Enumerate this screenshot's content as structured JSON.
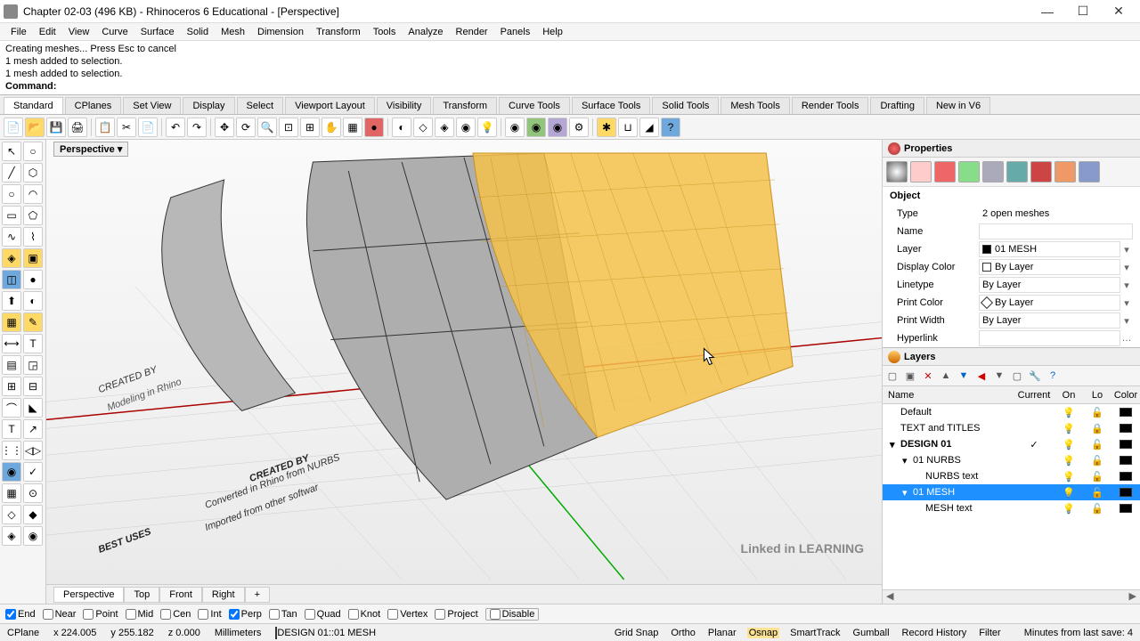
{
  "window": {
    "title": "Chapter 02-03 (496 KB) - Rhinoceros 6 Educational - [Perspective]"
  },
  "menu": [
    "File",
    "Edit",
    "View",
    "Curve",
    "Surface",
    "Solid",
    "Mesh",
    "Dimension",
    "Transform",
    "Tools",
    "Analyze",
    "Render",
    "Panels",
    "Help"
  ],
  "command_history": [
    "Creating meshes... Press Esc to cancel",
    "1 mesh added to selection.",
    "1 mesh added to selection."
  ],
  "command_prompt": "Command:",
  "toolbar_tabs": [
    "Standard",
    "CPlanes",
    "Set View",
    "Display",
    "Select",
    "Viewport Layout",
    "Visibility",
    "Transform",
    "Curve Tools",
    "Surface Tools",
    "Solid Tools",
    "Mesh Tools",
    "Render Tools",
    "Drafting",
    "New in V6"
  ],
  "viewport": {
    "label": "Perspective",
    "annotations": {
      "created_by1": "CREATED BY",
      "created_by2": "CREATED BY",
      "sub1": "Converted in Rhino from NURBS",
      "sub2": "Imported from other softwar",
      "best_uses": "BEST USES",
      "small": "Modeling in Rhino"
    }
  },
  "view_tabs": [
    "Perspective",
    "Top",
    "Front",
    "Right"
  ],
  "properties": {
    "title": "Properties",
    "section": "Object",
    "rows": {
      "type": {
        "label": "Type",
        "value": "2 open meshes"
      },
      "name": {
        "label": "Name",
        "value": ""
      },
      "layer": {
        "label": "Layer",
        "value": "01 MESH"
      },
      "display_color": {
        "label": "Display Color",
        "value": "By Layer"
      },
      "linetype": {
        "label": "Linetype",
        "value": "By Layer"
      },
      "print_color": {
        "label": "Print Color",
        "value": "By Layer"
      },
      "print_width": {
        "label": "Print Width",
        "value": "By Layer"
      },
      "hyperlink": {
        "label": "Hyperlink",
        "value": ""
      }
    }
  },
  "layers": {
    "title": "Layers",
    "columns": [
      "Name",
      "Current",
      "On",
      "Lo",
      "Color"
    ],
    "rows": [
      {
        "name": "Default",
        "indent": 0,
        "expand": "",
        "current": "",
        "on": true,
        "lock": false,
        "color": "#000"
      },
      {
        "name": "TEXT and TITLES",
        "indent": 0,
        "expand": "",
        "current": "",
        "on": true,
        "lock": true,
        "color": "#000"
      },
      {
        "name": "DESIGN 01",
        "indent": 0,
        "expand": "▾",
        "current": "✓",
        "on": true,
        "lock": false,
        "color": "#000",
        "bold": true
      },
      {
        "name": "01 NURBS",
        "indent": 1,
        "expand": "▾",
        "current": "",
        "on": true,
        "lock": false,
        "color": "#000"
      },
      {
        "name": "NURBS text",
        "indent": 2,
        "expand": "",
        "current": "",
        "on": true,
        "lock": false,
        "color": "#000"
      },
      {
        "name": "01 MESH",
        "indent": 1,
        "expand": "▾",
        "current": "",
        "on": true,
        "lock": false,
        "color": "#000",
        "selected": true
      },
      {
        "name": "MESH text",
        "indent": 2,
        "expand": "",
        "current": "",
        "on": true,
        "lock": false,
        "color": "#000"
      }
    ]
  },
  "osnaps": [
    {
      "label": "End",
      "checked": true
    },
    {
      "label": "Near",
      "checked": false
    },
    {
      "label": "Point",
      "checked": false
    },
    {
      "label": "Mid",
      "checked": false
    },
    {
      "label": "Cen",
      "checked": false
    },
    {
      "label": "Int",
      "checked": false
    },
    {
      "label": "Perp",
      "checked": true
    },
    {
      "label": "Tan",
      "checked": false
    },
    {
      "label": "Quad",
      "checked": false
    },
    {
      "label": "Knot",
      "checked": false
    },
    {
      "label": "Vertex",
      "checked": false
    },
    {
      "label": "Project",
      "checked": false
    }
  ],
  "osnap_disable": "Disable",
  "status": {
    "cplane": "CPlane",
    "x": "x 224.005",
    "y": "y 255.182",
    "z": "z 0.000",
    "units": "Millimeters",
    "layer": "DESIGN 01::01 MESH",
    "items": [
      "Grid Snap",
      "Ortho",
      "Planar",
      "Osnap",
      "SmartTrack",
      "Gumball",
      "Record History",
      "Filter"
    ],
    "lastsave": "Minutes from last save: 4",
    "highlight": "Osnap"
  },
  "watermark": "Linked in LEARNING"
}
